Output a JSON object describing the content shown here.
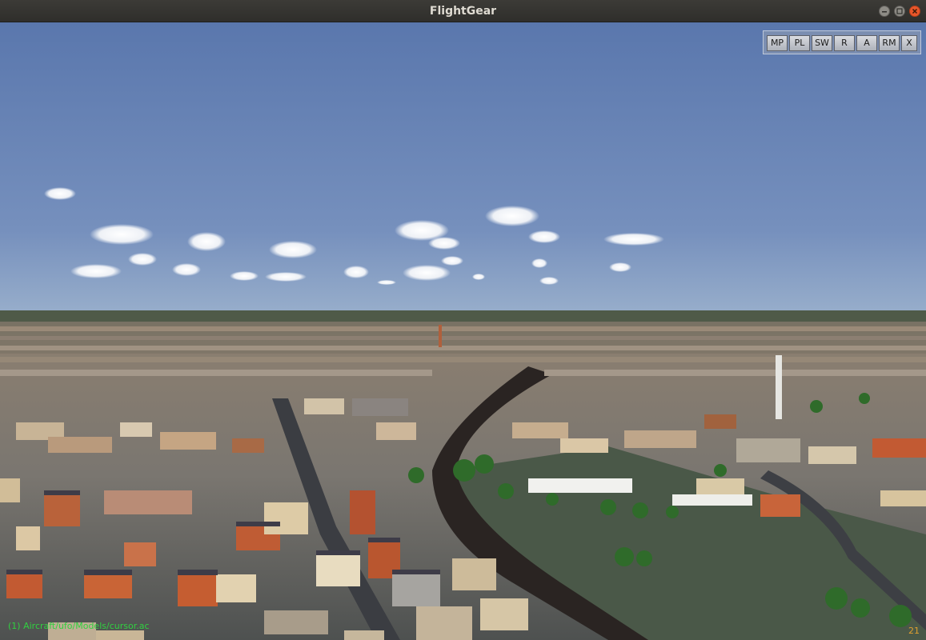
{
  "window": {
    "title": "FlightGear"
  },
  "toolbar": {
    "buttons": [
      "MP",
      "PL",
      "SW",
      "R",
      "A",
      "RM",
      "X"
    ]
  },
  "hud": {
    "status_text": "(1) Aircraft/ufo/Models/cursor.ac",
    "fps": "21"
  },
  "colors": {
    "sky_top": "#5a77ad",
    "sky_horizon": "#9ab0cc",
    "status_text": "#30d040",
    "close_button": "#e9562a"
  }
}
